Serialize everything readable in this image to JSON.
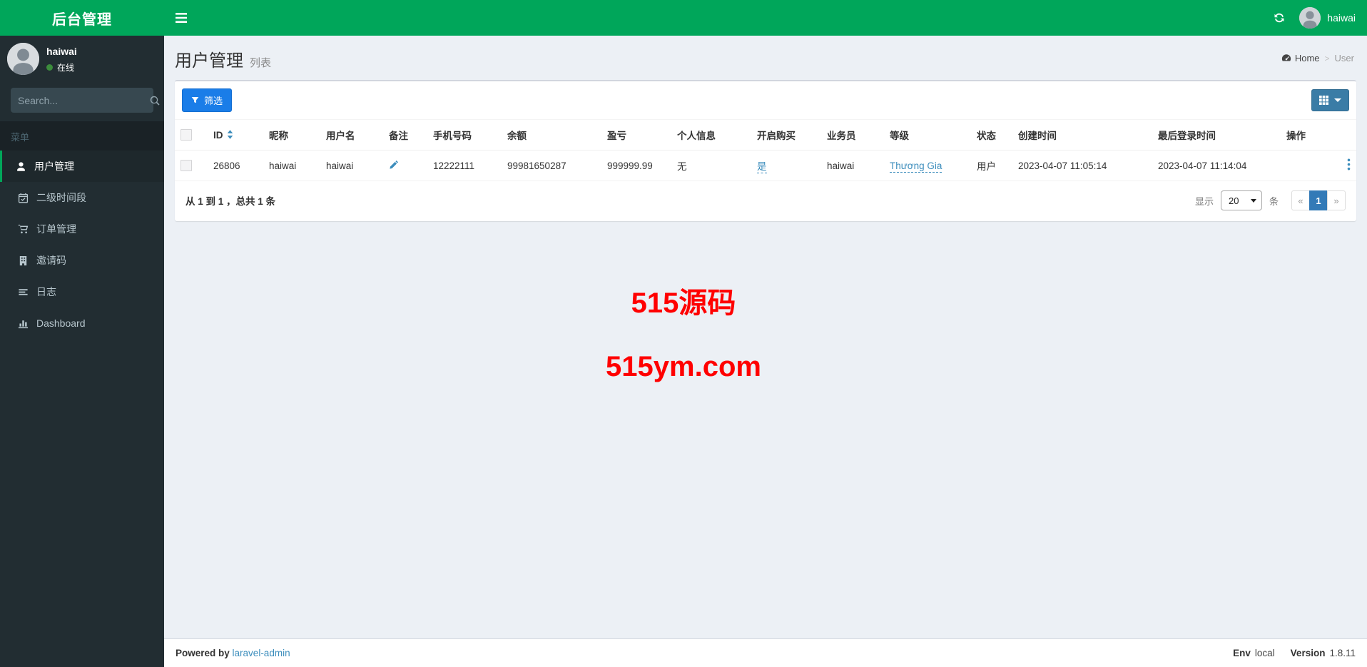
{
  "app": {
    "logo_text": "后台管理"
  },
  "topbar": {
    "username": "haiwai",
    "refresh_icon": "refresh-icon"
  },
  "sidebar": {
    "user": {
      "name": "haiwai",
      "status": "在线"
    },
    "search_placeholder": "Search...",
    "menu_header": "菜单",
    "items": [
      {
        "name": "users",
        "label": "用户管理",
        "icon": "user-icon",
        "active": true
      },
      {
        "name": "time-periods",
        "label": "二级时间段",
        "icon": "calendar-icon",
        "active": false
      },
      {
        "name": "orders",
        "label": "订单管理",
        "icon": "cart-icon",
        "active": false
      },
      {
        "name": "invite-codes",
        "label": "邀请码",
        "icon": "building-icon",
        "active": false
      },
      {
        "name": "logs",
        "label": "日志",
        "icon": "list-icon",
        "active": false
      },
      {
        "name": "dashboard",
        "label": "Dashboard",
        "icon": "bar-chart-icon",
        "active": false
      }
    ]
  },
  "page": {
    "title": "用户管理",
    "subtitle": "列表",
    "breadcrumb": {
      "home_icon": "dashboard-icon",
      "home": "Home",
      "separator": ">",
      "current": "User"
    }
  },
  "toolbar": {
    "filter_label": "筛选",
    "filter_icon": "filter-icon",
    "columns_icon": "table-grid-icon"
  },
  "table": {
    "columns": [
      {
        "key": "id",
        "label": "ID",
        "sortable": true
      },
      {
        "key": "nickname",
        "label": "昵称"
      },
      {
        "key": "username",
        "label": "用户名"
      },
      {
        "key": "remark",
        "label": "备注"
      },
      {
        "key": "phone",
        "label": "手机号码"
      },
      {
        "key": "balance",
        "label": "余额"
      },
      {
        "key": "profit",
        "label": "盈亏"
      },
      {
        "key": "personal_info",
        "label": "个人信息"
      },
      {
        "key": "purchase_enabled",
        "label": "开启购买"
      },
      {
        "key": "salesman",
        "label": "业务员"
      },
      {
        "key": "level",
        "label": "等级"
      },
      {
        "key": "status",
        "label": "状态"
      },
      {
        "key": "created_at",
        "label": "创建时间"
      },
      {
        "key": "last_login",
        "label": "最后登录时间"
      },
      {
        "key": "actions",
        "label": "操作"
      }
    ],
    "row": {
      "id": "26806",
      "nickname": "haiwai",
      "username": "haiwai",
      "remark_icon": "pencil-icon",
      "phone": "12222111",
      "balance": "99981650287",
      "profit": "999999.99",
      "personal_info": "无",
      "purchase_enabled": "是",
      "salesman": "haiwai",
      "level": "Thương Gia",
      "status": "用户",
      "created_at": "2023-04-07 11:05:14",
      "last_login": "2023-04-07 11:14:04",
      "actions_icon": "ellipsis-v-icon"
    }
  },
  "pagination": {
    "summary": "从 1 到 1 ，总共 1 条",
    "show_label": "显示",
    "per_page": "20",
    "unit_label": "条",
    "prev_label": "«",
    "current_page": "1",
    "next_label": "»"
  },
  "watermark": {
    "line1": "515源码",
    "line2": "515ym.com",
    "color": "#ff0000"
  },
  "footer": {
    "powered_by_label": "Powered by",
    "powered_link_text": "laravel-admin",
    "env_label": "Env",
    "env_value": "local",
    "version_label": "Version",
    "version_value": "1.8.11"
  },
  "colors": {
    "brand_green": "#00a65a",
    "sidebar_bg": "#222d32",
    "content_bg": "#ecf0f5",
    "link_blue": "#3c8dbc",
    "filter_button": "#1a7de8",
    "columns_button": "#3a7ca6",
    "active_page": "#337ab7",
    "watermark_red": "#ff0000"
  }
}
